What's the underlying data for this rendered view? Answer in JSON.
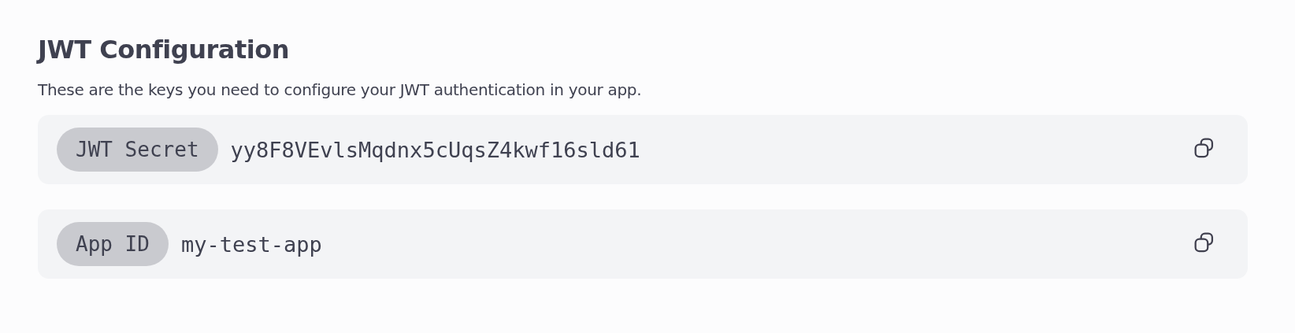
{
  "title": "JWT Configuration",
  "description": "These are the keys you need to configure your JWT authentication in your app.",
  "keys": [
    {
      "label": "JWT Secret",
      "value": "yy8F8VEvlsMqdnx5cUqsZ4kwf16sld61"
    },
    {
      "label": "App ID",
      "value": "my-test-app"
    }
  ]
}
